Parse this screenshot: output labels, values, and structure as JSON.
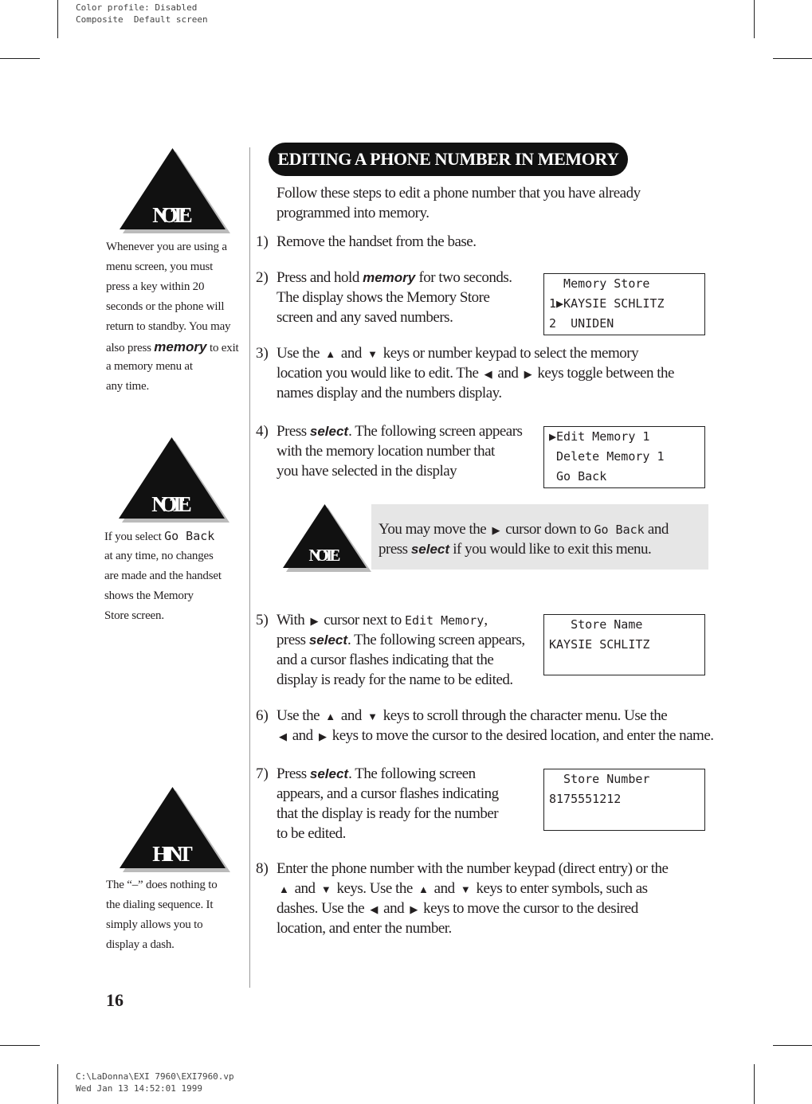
{
  "header": {
    "line1": "Color profile: Disabled",
    "line2": "Composite  Default screen"
  },
  "footer": {
    "line1": "C:\\LaDonna\\EXI 7960\\EXI7960.vp",
    "line2": "Wed Jan 13 14:52:01 1999"
  },
  "title": "EDITING A PHONE NUMBER IN MEMORY",
  "page_number": "16",
  "sidebar": [
    {
      "badge": "NOTE",
      "lines": [
        [
          [
            "t",
            "Whenever you are using a"
          ]
        ],
        [
          [
            "t",
            "menu screen, you must"
          ]
        ],
        [
          [
            "t",
            "press a key within 20"
          ]
        ],
        [
          [
            "t",
            "seconds or the phone will"
          ]
        ],
        [
          [
            "t",
            "return to standby. You may"
          ]
        ],
        [
          [
            "t",
            "also press "
          ],
          [
            "b",
            "memory"
          ],
          [
            "t",
            " to exit"
          ]
        ],
        [
          [
            "t",
            "a memory menu at"
          ]
        ],
        [
          [
            "t",
            "any time."
          ]
        ]
      ]
    },
    {
      "badge": "NOTE",
      "lines": [
        [
          [
            "t",
            "If you select "
          ],
          [
            "m",
            "Go Back"
          ]
        ],
        [
          [
            "t",
            "at any time, no changes"
          ]
        ],
        [
          [
            "t",
            "are made and the handset"
          ]
        ],
        [
          [
            "t",
            "shows the Memory"
          ]
        ],
        [
          [
            "t",
            "Store screen."
          ]
        ]
      ]
    },
    {
      "badge": "HINT",
      "lines": [
        [
          [
            "t",
            "The “–” does nothing to"
          ]
        ],
        [
          [
            "t",
            "the dialing sequence. It"
          ]
        ],
        [
          [
            "t",
            "simply allows you to"
          ]
        ],
        [
          [
            "t",
            "display a dash."
          ]
        ]
      ]
    }
  ],
  "intro": [
    [
      [
        "t",
        "Follow these steps to edit a phone number that you have already"
      ]
    ],
    [
      [
        "t",
        "programmed into memory."
      ]
    ]
  ],
  "steps": [
    {
      "num": "1)",
      "lines": [
        [
          [
            "t",
            "Remove the handset from the base."
          ]
        ]
      ]
    },
    {
      "num": "2)",
      "lines": [
        [
          [
            "t",
            "Press and hold "
          ],
          [
            "b",
            "memory"
          ],
          [
            "t",
            " for two seconds."
          ]
        ],
        [
          [
            "t",
            "The display shows the Memory Store"
          ]
        ],
        [
          [
            "t",
            "screen and any saved numbers."
          ]
        ]
      ]
    },
    {
      "num": "3)",
      "lines": [
        [
          [
            "t",
            "Use the "
          ],
          [
            "a",
            "▲"
          ],
          [
            "t",
            " and "
          ],
          [
            "a",
            "▼"
          ],
          [
            "t",
            " keys or number keypad to select the memory"
          ]
        ],
        [
          [
            "t",
            "location you would like to edit. The "
          ],
          [
            "a",
            "◀"
          ],
          [
            "t",
            " and "
          ],
          [
            "a",
            "▶"
          ],
          [
            "t",
            " keys toggle between the"
          ]
        ],
        [
          [
            "t",
            "names display and the numbers display."
          ]
        ]
      ]
    },
    {
      "num": "4)",
      "lines": [
        [
          [
            "t",
            "Press "
          ],
          [
            "b",
            "select"
          ],
          [
            "t",
            ". The following screen appears"
          ]
        ],
        [
          [
            "t",
            "with the memory location number that"
          ]
        ],
        [
          [
            "t",
            "you have selected in the display"
          ]
        ]
      ]
    },
    {
      "num": "5)",
      "lines": [
        [
          [
            "t",
            "With "
          ],
          [
            "a",
            "▶"
          ],
          [
            "t",
            " cursor next to "
          ],
          [
            "m",
            "Edit Memory"
          ],
          [
            "t",
            ","
          ]
        ],
        [
          [
            "t",
            "press "
          ],
          [
            "b",
            "select"
          ],
          [
            "t",
            ". The following screen appears,"
          ]
        ],
        [
          [
            "t",
            " and a cursor flashes indicating that the"
          ]
        ],
        [
          [
            "t",
            "display is ready for the name to be edited."
          ]
        ]
      ]
    },
    {
      "num": "6)",
      "lines": [
        [
          [
            "t",
            "Use the "
          ],
          [
            "a",
            "▲"
          ],
          [
            "t",
            " and "
          ],
          [
            "a",
            "▼"
          ],
          [
            "t",
            " keys to scroll through the character menu. Use the"
          ]
        ],
        [
          [
            "a",
            "◀"
          ],
          [
            "t",
            " and "
          ],
          [
            "a",
            "▶"
          ],
          [
            "t",
            " keys to move the cursor to the desired location, and enter the name."
          ]
        ]
      ]
    },
    {
      "num": "7)",
      "lines": [
        [
          [
            "t",
            "Press "
          ],
          [
            "b",
            "select"
          ],
          [
            "t",
            ". The following screen"
          ]
        ],
        [
          [
            "t",
            "appears, and a cursor flashes indicating"
          ]
        ],
        [
          [
            "t",
            "that the display is ready for the number"
          ]
        ],
        [
          [
            "t",
            "to be edited."
          ]
        ]
      ]
    },
    {
      "num": "8)",
      "lines": [
        [
          [
            "t",
            "Enter the phone number with the number keypad (direct entry) or the"
          ]
        ],
        [
          [
            "a",
            "▲"
          ],
          [
            "t",
            " and "
          ],
          [
            "a",
            "▼"
          ],
          [
            "t",
            " keys. Use the "
          ],
          [
            "a",
            "▲"
          ],
          [
            "t",
            " and "
          ],
          [
            "a",
            "▼"
          ],
          [
            "t",
            " keys to enter symbols, such as"
          ]
        ],
        [
          [
            "t",
            "dashes. Use the "
          ],
          [
            "a",
            "◀"
          ],
          [
            "t",
            " and "
          ],
          [
            "a",
            "▶"
          ],
          [
            "t",
            " keys to move the cursor to the desired"
          ]
        ],
        [
          [
            "t",
            "location, and enter the number."
          ]
        ]
      ]
    }
  ],
  "note_inline": {
    "badge": "NOTE",
    "lines": [
      [
        [
          "t",
          "You may move the "
        ],
        [
          "a",
          "▶"
        ],
        [
          "t",
          " cursor down to "
        ],
        [
          "m",
          "Go Back"
        ],
        [
          "t",
          " and"
        ]
      ],
      [
        [
          "t",
          "press "
        ],
        [
          "b",
          "select"
        ],
        [
          "t",
          " if you would like to exit this menu."
        ]
      ]
    ]
  },
  "screens": [
    {
      "lines": [
        "  Memory Store",
        "1▶KAYSIE SCHLITZ",
        "2  UNIDEN"
      ]
    },
    {
      "lines": [
        "▶Edit Memory 1",
        " Delete Memory 1",
        " Go Back"
      ]
    },
    {
      "lines": [
        "   Store Name",
        "KAYSIE SCHLITZ",
        ""
      ]
    },
    {
      "lines": [
        "  Store Number",
        "8175551212",
        ""
      ]
    }
  ]
}
